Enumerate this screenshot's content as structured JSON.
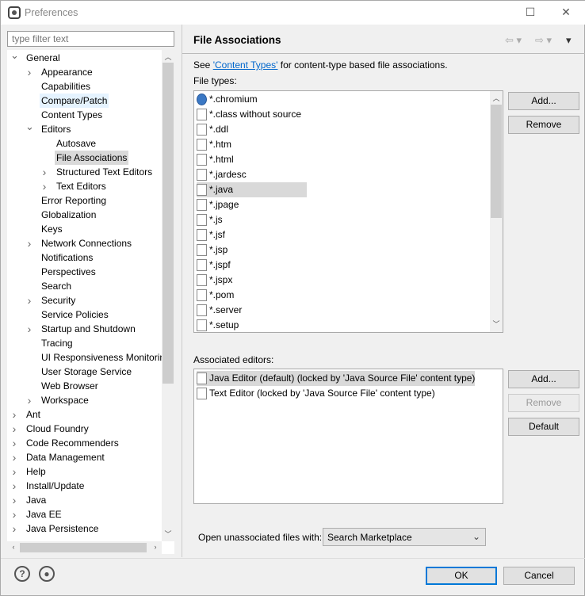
{
  "window": {
    "title": "Preferences"
  },
  "filter": {
    "placeholder": "type filter text"
  },
  "tree": [
    {
      "label": "General",
      "level": 0,
      "chev": "open"
    },
    {
      "label": "Appearance",
      "level": 1,
      "chev": "closed"
    },
    {
      "label": "Capabilities",
      "level": 1,
      "chev": ""
    },
    {
      "label": "Compare/Patch",
      "level": 1,
      "chev": "",
      "state": "hover"
    },
    {
      "label": "Content Types",
      "level": 1,
      "chev": ""
    },
    {
      "label": "Editors",
      "level": 1,
      "chev": "open"
    },
    {
      "label": "Autosave",
      "level": 2,
      "chev": ""
    },
    {
      "label": "File Associations",
      "level": 2,
      "chev": "",
      "state": "selected"
    },
    {
      "label": "Structured Text Editors",
      "level": 2,
      "chev": "closed"
    },
    {
      "label": "Text Editors",
      "level": 2,
      "chev": "closed"
    },
    {
      "label": "Error Reporting",
      "level": 1,
      "chev": ""
    },
    {
      "label": "Globalization",
      "level": 1,
      "chev": ""
    },
    {
      "label": "Keys",
      "level": 1,
      "chev": ""
    },
    {
      "label": "Network Connections",
      "level": 1,
      "chev": "closed"
    },
    {
      "label": "Notifications",
      "level": 1,
      "chev": ""
    },
    {
      "label": "Perspectives",
      "level": 1,
      "chev": ""
    },
    {
      "label": "Search",
      "level": 1,
      "chev": ""
    },
    {
      "label": "Security",
      "level": 1,
      "chev": "closed"
    },
    {
      "label": "Service Policies",
      "level": 1,
      "chev": ""
    },
    {
      "label": "Startup and Shutdown",
      "level": 1,
      "chev": "closed"
    },
    {
      "label": "Tracing",
      "level": 1,
      "chev": ""
    },
    {
      "label": "UI Responsiveness Monitoring",
      "level": 1,
      "chev": ""
    },
    {
      "label": "User Storage Service",
      "level": 1,
      "chev": ""
    },
    {
      "label": "Web Browser",
      "level": 1,
      "chev": ""
    },
    {
      "label": "Workspace",
      "level": 1,
      "chev": "closed"
    },
    {
      "label": "Ant",
      "level": 0,
      "chev": "closed"
    },
    {
      "label": "Cloud Foundry",
      "level": 0,
      "chev": "closed"
    },
    {
      "label": "Code Recommenders",
      "level": 0,
      "chev": "closed"
    },
    {
      "label": "Data Management",
      "level": 0,
      "chev": "closed"
    },
    {
      "label": "Help",
      "level": 0,
      "chev": "closed"
    },
    {
      "label": "Install/Update",
      "level": 0,
      "chev": "closed"
    },
    {
      "label": "Java",
      "level": 0,
      "chev": "closed"
    },
    {
      "label": "Java EE",
      "level": 0,
      "chev": "closed"
    },
    {
      "label": "Java Persistence",
      "level": 0,
      "chev": "closed"
    }
  ],
  "page": {
    "title": "File Associations",
    "intro_pre": "See ",
    "intro_link": "'Content Types'",
    "intro_post": " for content-type based file associations.",
    "file_types_label": "File types:",
    "file_types": [
      {
        "name": "*.chromium",
        "icon": "chromium-icon"
      },
      {
        "name": "*.class without source",
        "icon": "class-file-icon"
      },
      {
        "name": "*.ddl",
        "icon": "ddl-file-icon"
      },
      {
        "name": "*.htm",
        "icon": "html-file-icon"
      },
      {
        "name": "*.html",
        "icon": "html-file-icon"
      },
      {
        "name": "*.jardesc",
        "icon": "jar-file-icon"
      },
      {
        "name": "*.java",
        "icon": "java-file-icon",
        "selected": true
      },
      {
        "name": "*.jpage",
        "icon": "jpage-file-icon"
      },
      {
        "name": "*.js",
        "icon": "js-file-icon"
      },
      {
        "name": "*.jsf",
        "icon": "file-icon"
      },
      {
        "name": "*.jsp",
        "icon": "file-icon"
      },
      {
        "name": "*.jspf",
        "icon": "file-icon"
      },
      {
        "name": "*.jspx",
        "icon": "file-icon"
      },
      {
        "name": "*.pom",
        "icon": "maven-file-icon"
      },
      {
        "name": "*.server",
        "icon": "server-file-icon"
      },
      {
        "name": "*.setup",
        "icon": "setup-file-icon"
      }
    ],
    "add_label": "Add...",
    "remove_label": "Remove",
    "editors_label": "Associated editors:",
    "editors": [
      {
        "name": "Java Editor (default) (locked by 'Java Source File' content type)",
        "selected": true
      },
      {
        "name": "Text Editor (locked by 'Java Source File' content type)"
      }
    ],
    "editor_add_label": "Add...",
    "editor_remove_label": "Remove",
    "default_label": "Default",
    "unassoc_label": "Open unassociated files with:",
    "unassoc_value": "Search Marketplace"
  },
  "footer": {
    "ok": "OK",
    "cancel": "Cancel"
  }
}
